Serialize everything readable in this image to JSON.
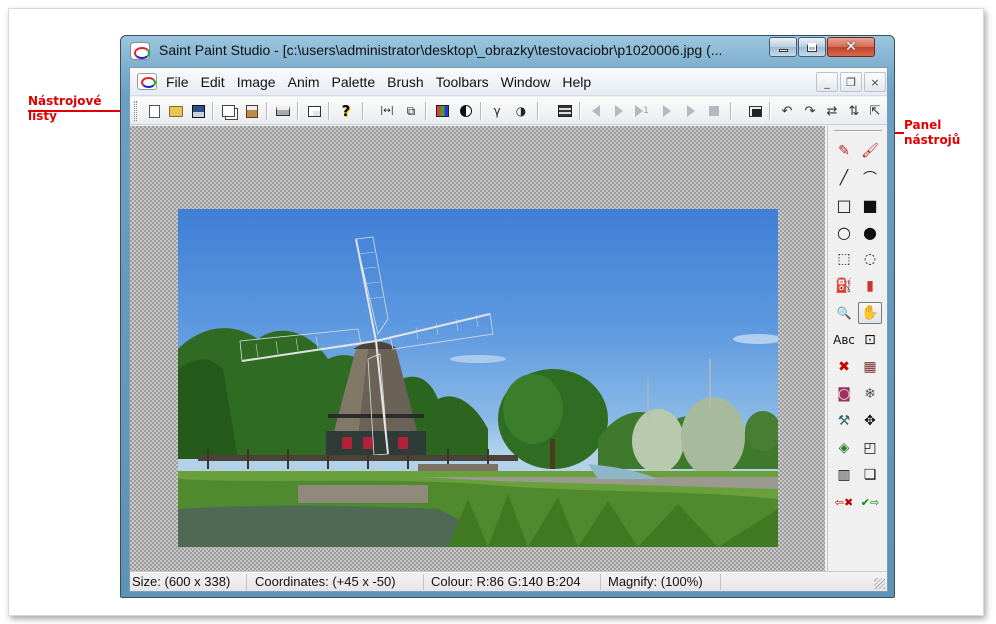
{
  "annotations": {
    "toolbars_label_line1": "Nástrojové",
    "toolbars_label_line2": "lišty",
    "panel_label_line1": "Panel",
    "panel_label_line2": "nástrojů",
    "color": "#e00000"
  },
  "window": {
    "title": "Saint Paint Studio - [c:\\users\\administrator\\desktop\\_obrazky\\testovaciobr\\p1020006.jpg (...",
    "controls": {
      "minimize": "minimize-icon",
      "maximize": "maximize-icon",
      "close": "close-icon"
    }
  },
  "menu": {
    "items": [
      "File",
      "Edit",
      "Image",
      "Anim",
      "Palette",
      "Brush",
      "Toolbars",
      "Window",
      "Help"
    ],
    "mdi": {
      "minimize": "_",
      "restore": "❐",
      "close": "×"
    }
  },
  "toolbar": {
    "buttons": [
      {
        "icon": "new-document-icon"
      },
      {
        "icon": "open-folder-icon"
      },
      {
        "icon": "save-disk-icon"
      },
      {
        "icon": "copy-icon"
      },
      {
        "icon": "paste-icon"
      },
      {
        "icon": "print-icon"
      },
      {
        "icon": "window-icon"
      },
      {
        "icon": "help-icon",
        "glyph": "?"
      },
      {
        "icon": "resize-icon",
        "glyph": "|↔|"
      },
      {
        "icon": "crop-icon",
        "glyph": "⧉"
      },
      {
        "icon": "palette-grid-icon"
      },
      {
        "icon": "contrast-icon"
      },
      {
        "icon": "gamma-icon",
        "glyph": "γ"
      },
      {
        "icon": "brightness-icon",
        "glyph": "◑"
      },
      {
        "icon": "film-frames-icon"
      },
      {
        "icon": "prev-frame-icon"
      },
      {
        "icon": "next-frame-icon"
      },
      {
        "icon": "play-once-icon",
        "glyph": "1"
      },
      {
        "icon": "play-loop-icon"
      },
      {
        "icon": "play-pingpong-icon"
      },
      {
        "icon": "stop-icon"
      },
      {
        "icon": "thumbnail-icon"
      },
      {
        "icon": "rotate-left-icon",
        "glyph": "↶"
      },
      {
        "icon": "rotate-right-icon",
        "glyph": "↷"
      },
      {
        "icon": "flip-icon",
        "glyph": "⇄"
      },
      {
        "icon": "mirror-icon",
        "glyph": "⇅"
      },
      {
        "icon": "transform-icon",
        "glyph": "⇱"
      }
    ]
  },
  "tools": [
    {
      "icon": "pen-icon",
      "glyph": "✎"
    },
    {
      "icon": "brush-icon",
      "glyph": "🖌"
    },
    {
      "icon": "line-icon",
      "glyph": "╱"
    },
    {
      "icon": "curve-icon",
      "glyph": "⌒"
    },
    {
      "icon": "rectangle-icon",
      "glyph": "□"
    },
    {
      "icon": "filled-rectangle-icon",
      "glyph": "■"
    },
    {
      "icon": "ellipse-icon",
      "glyph": "○"
    },
    {
      "icon": "filled-ellipse-icon",
      "glyph": "●"
    },
    {
      "icon": "rect-select-icon",
      "glyph": "⬚"
    },
    {
      "icon": "lasso-select-icon",
      "glyph": "◌"
    },
    {
      "icon": "fill-bucket-icon",
      "glyph": "⛽"
    },
    {
      "icon": "spray-can-icon",
      "glyph": "▮"
    },
    {
      "icon": "zoom-icon",
      "glyph": "🔍"
    },
    {
      "icon": "hand-pan-icon",
      "glyph": "✋"
    },
    {
      "icon": "text-icon",
      "glyph": "Aʙᴄ"
    },
    {
      "icon": "picker-icon",
      "glyph": "⊡"
    },
    {
      "icon": "color-replace-icon",
      "glyph": "✖"
    },
    {
      "icon": "pattern-icon",
      "glyph": "▦"
    },
    {
      "icon": "magnifier-area-icon",
      "glyph": "◙"
    },
    {
      "icon": "effects-icon",
      "glyph": "❄"
    },
    {
      "icon": "clone-icon",
      "glyph": "⚒"
    },
    {
      "icon": "move-icon",
      "glyph": "✥"
    },
    {
      "icon": "frame-icon",
      "glyph": "◈"
    },
    {
      "icon": "canvas-icon",
      "glyph": "◰"
    },
    {
      "icon": "film-icon",
      "glyph": "▥"
    },
    {
      "icon": "layers-icon",
      "glyph": "❏"
    },
    {
      "icon": "undo-icon",
      "glyph": "⇦✖"
    },
    {
      "icon": "redo-icon",
      "glyph": "✔⇨"
    }
  ],
  "status": {
    "size": "Size: (600 x 338)",
    "coordinates": "Coordinates: (+45 x -50)",
    "colour": "Colour: R:86 G:140 B:204",
    "magnify": "Magnify: (100%)"
  },
  "image": {
    "width": 600,
    "height": 338,
    "sky_color": "#568ccc",
    "description_icon": "windmill-photo"
  }
}
